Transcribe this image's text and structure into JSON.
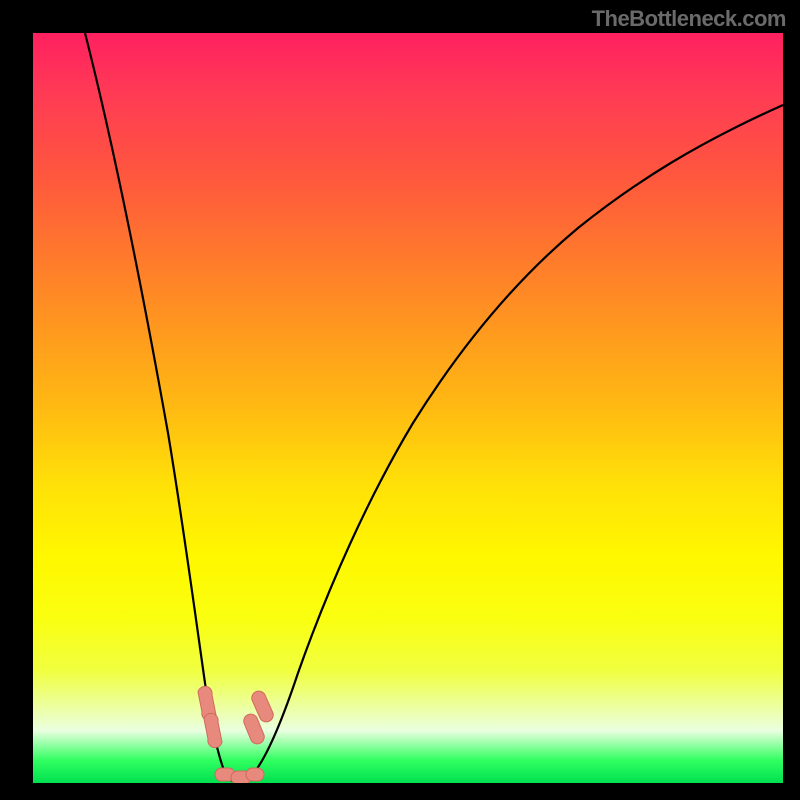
{
  "watermark": "TheBottleneck.com",
  "chart_data": {
    "type": "line",
    "title": "",
    "xlabel": "",
    "ylabel": "",
    "x_range": [
      0,
      100
    ],
    "y_range": [
      0,
      100
    ],
    "series": [
      {
        "name": "bottleneck-curve",
        "description": "V-shaped curve; minimum near x≈26 at y≈0",
        "x": [
          7,
          10,
          13,
          16,
          19,
          21,
          23,
          24.5,
          26,
          27.5,
          29,
          31,
          34,
          38,
          43,
          49,
          56,
          64,
          73,
          83,
          94,
          100
        ],
        "y": [
          100,
          84,
          68,
          52,
          36,
          22,
          10,
          3,
          0,
          2,
          6,
          14,
          27,
          41,
          53,
          63,
          71,
          77,
          82,
          86,
          89,
          91
        ]
      }
    ],
    "highlights": [
      {
        "name": "left-cluster",
        "approx_x": 22.5,
        "range_x": [
          22,
          23.0
        ],
        "shape": "segmented-capsule"
      },
      {
        "name": "right-cluster",
        "approx_x": 30.0,
        "range_x": [
          29.5,
          30.7
        ],
        "shape": "segmented-capsule"
      },
      {
        "name": "bottom-cluster",
        "approx_x": 26.0,
        "range_x": [
          24.5,
          28.5
        ],
        "shape": "segmented-capsule"
      }
    ],
    "gradient": {
      "direction": "top-to-bottom",
      "stops": [
        {
          "pos": 0.0,
          "color": "#ff2060"
        },
        {
          "pos": 0.5,
          "color": "#ffba12"
        },
        {
          "pos": 0.7,
          "color": "#fff800"
        },
        {
          "pos": 0.97,
          "color": "#30ff60"
        },
        {
          "pos": 1.0,
          "color": "#00e050"
        }
      ]
    }
  }
}
